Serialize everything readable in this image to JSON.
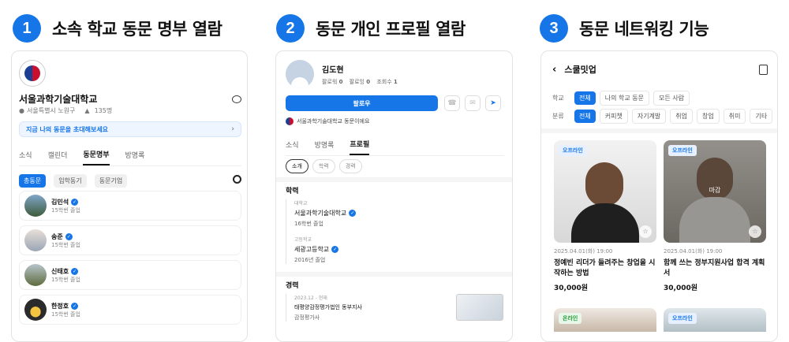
{
  "steps": [
    {
      "num": "1",
      "title": "소속 학교 동문 명부 열람"
    },
    {
      "num": "2",
      "title": "동문 개인 프로필 열람"
    },
    {
      "num": "3",
      "title": "동문 네트워킹 기능"
    }
  ],
  "p1": {
    "school": "서울과학기술대학교",
    "location": "서울특별시 노원구",
    "count": "135명",
    "banner": "지금 나의 동문을 초대해보세요",
    "tabs": [
      "소식",
      "캘린더",
      "동문명부",
      "방명록"
    ],
    "filters": [
      "총동문",
      "입학동기",
      "동문기업"
    ],
    "members": [
      {
        "name": "김민석",
        "sub": "15학번 졸업"
      },
      {
        "name": "송준",
        "sub": "15학번 졸업"
      },
      {
        "name": "신태호",
        "sub": "15학번 졸업"
      },
      {
        "name": "한정호",
        "sub": "15학번 졸업"
      }
    ]
  },
  "p2": {
    "name": "김도현",
    "followers_label": "팔로워",
    "followers": "0",
    "following_label": "팔로잉",
    "following": "0",
    "views_label": "조회수",
    "views": "1",
    "follow": "팔로우",
    "school_note": "서울과학기술대학교 동문이에요",
    "tabs": [
      "소식",
      "방명록",
      "프로필"
    ],
    "subtabs": [
      "소개",
      "학력",
      "경력"
    ],
    "edu_title": "학력",
    "edu": [
      {
        "type": "대학교",
        "name": "서울과학기술대학교",
        "detail": "16학번 졸업"
      },
      {
        "type": "고등학교",
        "name": "세광고등학교",
        "detail": "2016년 졸업"
      }
    ],
    "career_title": "경력",
    "career": {
      "period": "2023.12 - 현재",
      "org": "태평양감정평가법인 동부지사",
      "role": "감정평가사"
    }
  },
  "p3": {
    "title": "스쿨밋업",
    "school_label": "학교",
    "school_filters": [
      "전체",
      "나의 학교 동문",
      "모든 사람"
    ],
    "cat_label": "분류",
    "cat_filters": [
      "전체",
      "커피챗",
      "자기계발",
      "취업",
      "창업",
      "취미",
      "기타"
    ],
    "cards": [
      {
        "badge": "오프라인",
        "date": "2025.04.01(화) 19:00",
        "title": "정예빈 리더가 들려주는 창업을 시작하는 방법",
        "price": "30,000원",
        "overlay": ""
      },
      {
        "badge": "오프라인",
        "date": "2025.04.01(화) 19:00",
        "title": "함께 쓰는 정부지원사업 합격 계획서",
        "price": "30,000원",
        "overlay": "마감"
      }
    ],
    "bottom_badges": [
      "온라인",
      "오프라인"
    ]
  },
  "colors": {
    "accent": "#1676e8"
  }
}
